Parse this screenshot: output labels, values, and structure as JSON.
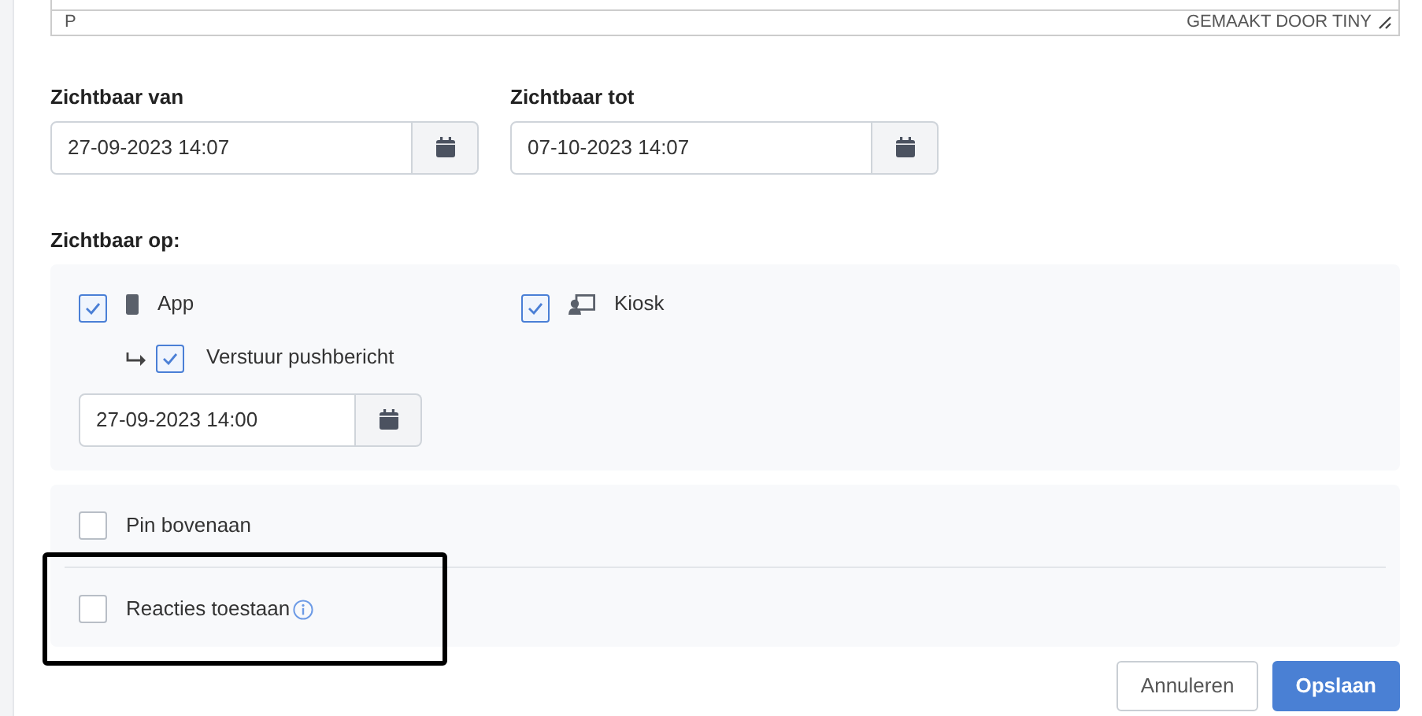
{
  "editor_status": {
    "path": "P",
    "branding": "GEMAAKT DOOR TINY"
  },
  "visible_from": {
    "label": "Zichtbaar van",
    "value": "27-09-2023 14:07"
  },
  "visible_until": {
    "label": "Zichtbaar tot",
    "value": "07-10-2023 14:07"
  },
  "visible_on": {
    "label": "Zichtbaar op:",
    "channels": [
      {
        "kind": "app",
        "label": "App",
        "checked": true
      },
      {
        "kind": "kiosk",
        "label": "Kiosk",
        "checked": true
      }
    ],
    "push": {
      "label": "Verstuur pushbericht",
      "checked": true,
      "value": "27-09-2023 14:00"
    }
  },
  "options": [
    {
      "label": "Pin bovenaan",
      "checked": false,
      "info": false,
      "highlighted": false
    },
    {
      "label": "Reacties toestaan",
      "checked": false,
      "info": true,
      "highlighted": true
    }
  ],
  "buttons": [
    {
      "kind": "secondary",
      "label": "Annuleren"
    },
    {
      "kind": "primary",
      "label": "Opslaan"
    }
  ]
}
